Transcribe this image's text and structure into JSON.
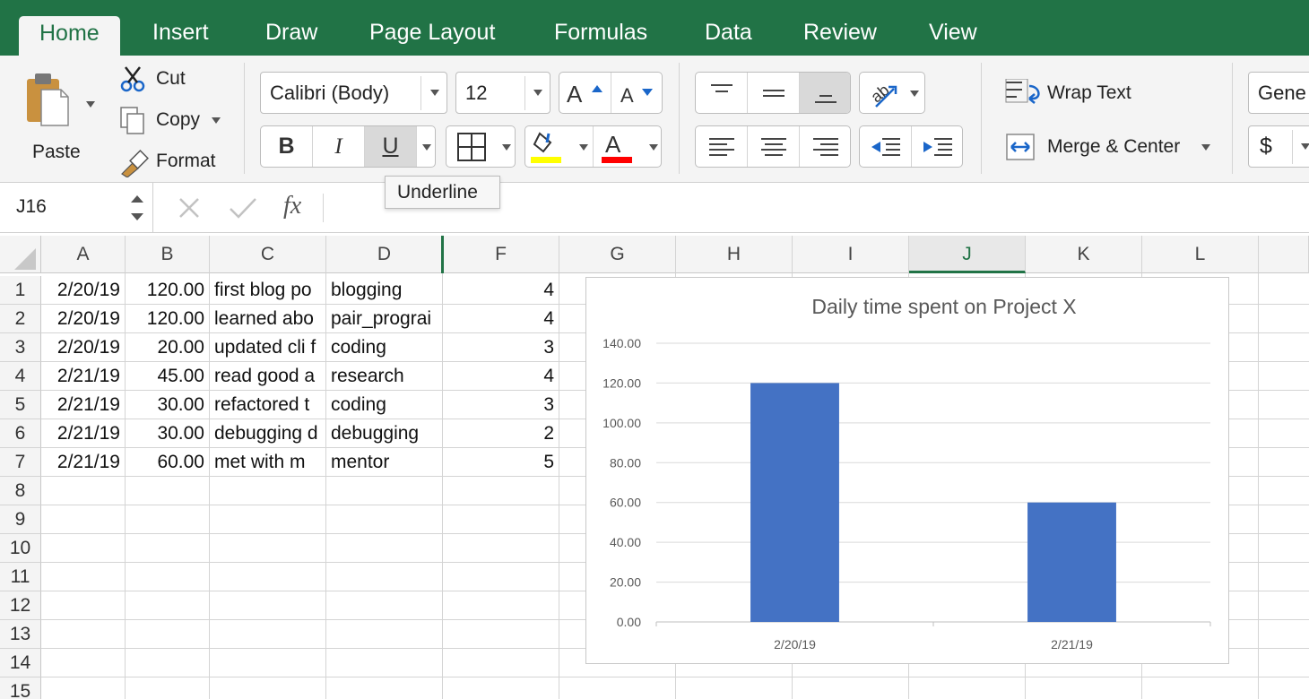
{
  "tabs": [
    {
      "label": "Home",
      "active": true
    },
    {
      "label": "Insert"
    },
    {
      "label": "Draw"
    },
    {
      "label": "Page Layout"
    },
    {
      "label": "Formulas"
    },
    {
      "label": "Data"
    },
    {
      "label": "Review"
    },
    {
      "label": "View"
    }
  ],
  "clipboard": {
    "paste": "Paste",
    "cut": "Cut",
    "copy": "Copy",
    "format": "Format"
  },
  "font": {
    "name": "Calibri (Body)",
    "size": "12",
    "bold": "B",
    "italic": "I",
    "underline": "U",
    "fill_color": "#ffff00",
    "font_color": "#ff0000"
  },
  "alignment": {
    "wrap_text": "Wrap Text",
    "merge_center": "Merge & Center"
  },
  "number": {
    "format": "Gene",
    "currency": "$"
  },
  "tooltip": "Underline",
  "formula_bar": {
    "name_box": "J16",
    "fx": "fx"
  },
  "columns": [
    "A",
    "B",
    "C",
    "D",
    "F",
    "G",
    "H",
    "I",
    "J",
    "K",
    "L"
  ],
  "selected_column": "J",
  "rows": [
    "1",
    "2",
    "3",
    "4",
    "5",
    "6",
    "7",
    "8",
    "9",
    "10",
    "11",
    "12",
    "13",
    "14",
    "15"
  ],
  "cells": [
    {
      "A": "2/20/19",
      "B": "120.00",
      "C": "first blog po",
      "D": "blogging",
      "F": "4"
    },
    {
      "A": "2/20/19",
      "B": "120.00",
      "C": "learned abo",
      "D": "pair_prograi",
      "F": "4"
    },
    {
      "A": "2/20/19",
      "B": "20.00",
      "C": "updated cli f",
      "D": "coding",
      "F": "3"
    },
    {
      "A": "2/21/19",
      "B": "45.00",
      "C": "read good a",
      "D": "research",
      "F": "4"
    },
    {
      "A": "2/21/19",
      "B": "30.00",
      "C": "refactored t",
      "D": "coding",
      "F": "3"
    },
    {
      "A": "2/21/19",
      "B": "30.00",
      "C": "debugging d",
      "D": "debugging",
      "F": "2"
    },
    {
      "A": "2/21/19",
      "B": "60.00",
      "C": "met with m",
      "D": "mentor",
      "F": "5"
    }
  ],
  "colors": {
    "accent": "#217346",
    "bar": "#4472c4"
  },
  "chart_data": {
    "type": "bar",
    "title": "Daily time spent on Project X",
    "categories": [
      "2/20/19",
      "2/21/19"
    ],
    "values": [
      120,
      60
    ],
    "ylim": [
      0,
      140
    ],
    "yticks": [
      "0.00",
      "20.00",
      "40.00",
      "60.00",
      "80.00",
      "100.00",
      "120.00",
      "140.00"
    ],
    "grid": true,
    "xlabel": "",
    "ylabel": ""
  }
}
